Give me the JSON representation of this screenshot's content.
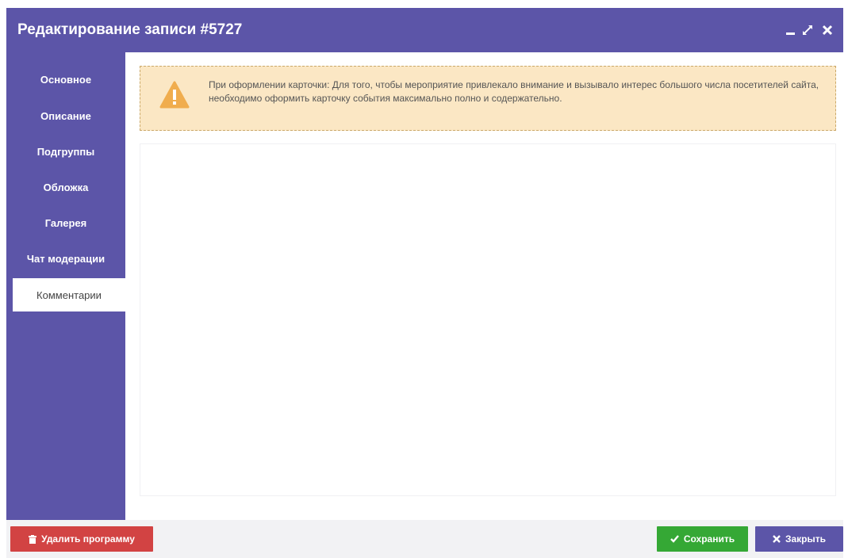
{
  "window": {
    "title": "Редактирование записи #5727"
  },
  "sidebar": {
    "items": [
      {
        "label": "Основное"
      },
      {
        "label": "Описание"
      },
      {
        "label": "Подгруппы"
      },
      {
        "label": "Обложка"
      },
      {
        "label": "Галерея"
      },
      {
        "label": "Чат модерации"
      },
      {
        "label": "Комментарии",
        "active": true
      }
    ]
  },
  "alert": {
    "icon": "warning-icon",
    "text": "При оформлении карточки: Для того, чтобы мероприятие привлекало внимание и вызывало интерес большого числа посетителей сайта, необходимо оформить карточку события максимально полно и содержательно."
  },
  "footer": {
    "delete_label": "Удалить программу",
    "save_label": "Сохранить",
    "close_label": "Закрыть"
  },
  "colors": {
    "brand": "#5c55a8",
    "danger": "#d24343",
    "success": "#35a835",
    "warning_bg": "#fbe7c4",
    "warning_icon": "#f0ad4e"
  }
}
